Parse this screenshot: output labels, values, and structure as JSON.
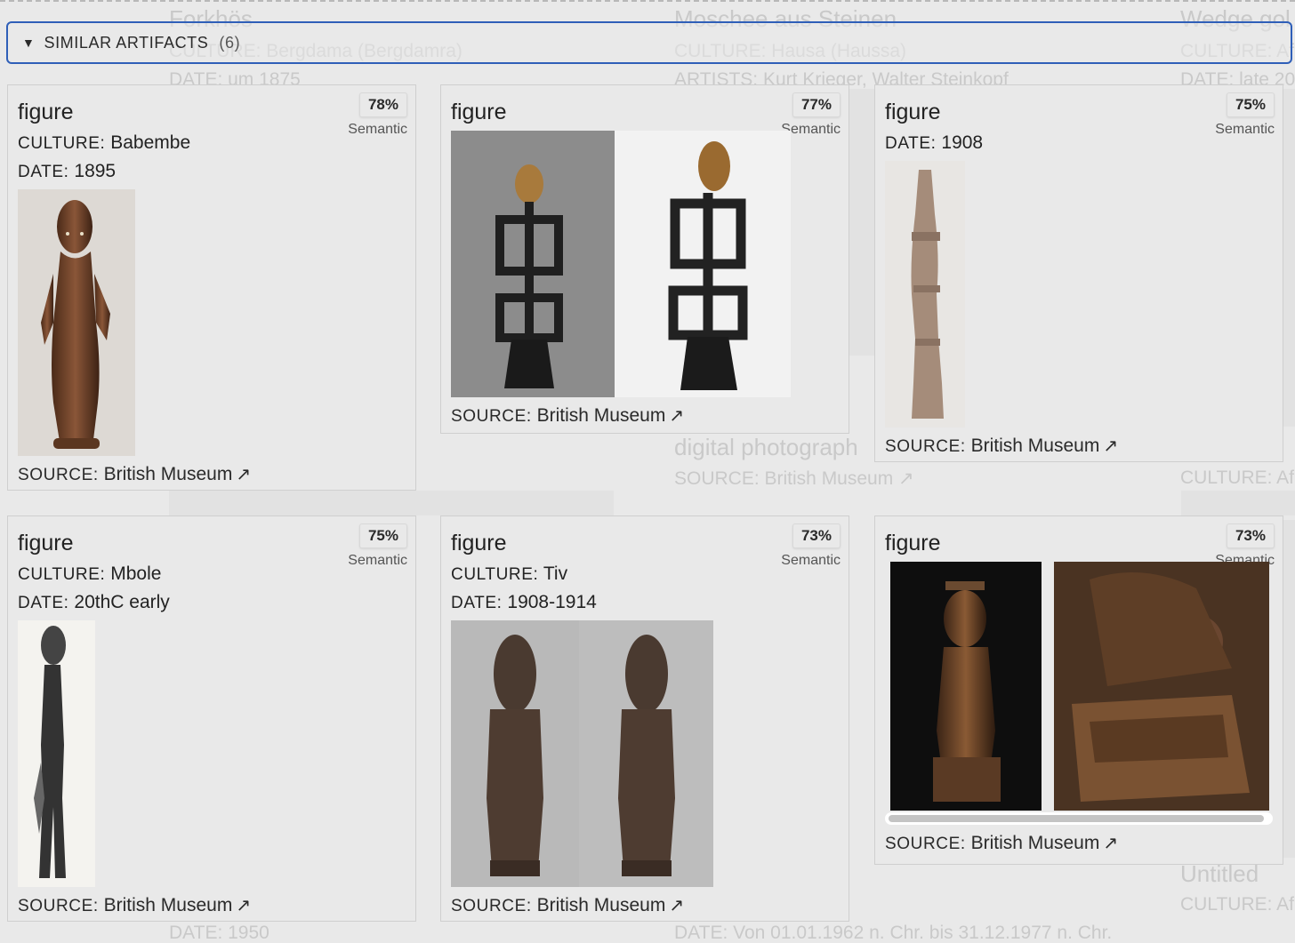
{
  "background": {
    "texts": [
      "Forkhös",
      "CULTURE: Bergdama (Bergdamra)",
      "DATE: um 1875",
      "Moschee aus Steinen",
      "CULTURE: Hausa (Haussa)",
      "ARTISTS: Kurt Krieger, Walter Steinkopf",
      "Wedge gol",
      "CULTURE: Afr",
      "DATE: late 20",
      "digital photograph",
      "SOURCE: British Museum ↗",
      "CULTURE: Afr",
      "Untitled",
      "CULTURE: Afr",
      "DATE: 1950",
      "DATE: Von 01.01.1962 n. Chr. bis 31.12.1977 n. Chr."
    ]
  },
  "header": {
    "caret": "▼",
    "title": "SIMILAR ARTIFACTS",
    "count": "(6)"
  },
  "labels": {
    "culture": "CULTURE:",
    "date": "DATE:",
    "source": "SOURCE:",
    "semantic": "Semantic",
    "arrow": "↗"
  },
  "cards": [
    {
      "title": "figure",
      "score": "78%",
      "culture": "Babembe",
      "date": "1895",
      "source": "British Museum"
    },
    {
      "title": "figure",
      "score": "77%",
      "source": "British Museum"
    },
    {
      "title": "figure",
      "score": "75%",
      "date": "1908",
      "source": "British Museum"
    },
    {
      "title": "figure",
      "score": "75%",
      "culture": "Mbole",
      "date": "20thC early",
      "source": "British Museum"
    },
    {
      "title": "figure",
      "score": "73%",
      "culture": "Tiv",
      "date": "1908-1914",
      "source": "British Museum"
    },
    {
      "title": "figure",
      "score": "73%",
      "source": "British Museum"
    }
  ]
}
